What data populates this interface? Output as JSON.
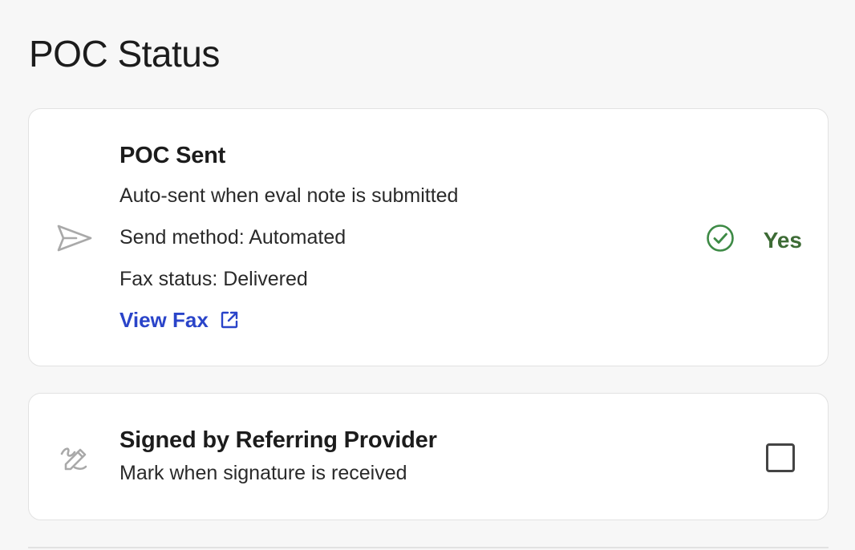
{
  "page": {
    "title": "POC Status"
  },
  "poc_sent": {
    "icon": "send-icon",
    "title": "POC Sent",
    "lines": [
      "Auto-sent when eval note is submitted",
      "Send method: Automated",
      "Fax status: Delivered"
    ],
    "link_label": "View Fax",
    "link_icon": "external-link-icon",
    "status_icon": "check-circle-icon",
    "status_label": "Yes",
    "status_color": "#3d6b35",
    "link_color": "#2a44c9"
  },
  "signed": {
    "icon": "signature-icon",
    "title": "Signed by Referring Provider",
    "subtitle": "Mark when signature is received",
    "checked": false
  }
}
